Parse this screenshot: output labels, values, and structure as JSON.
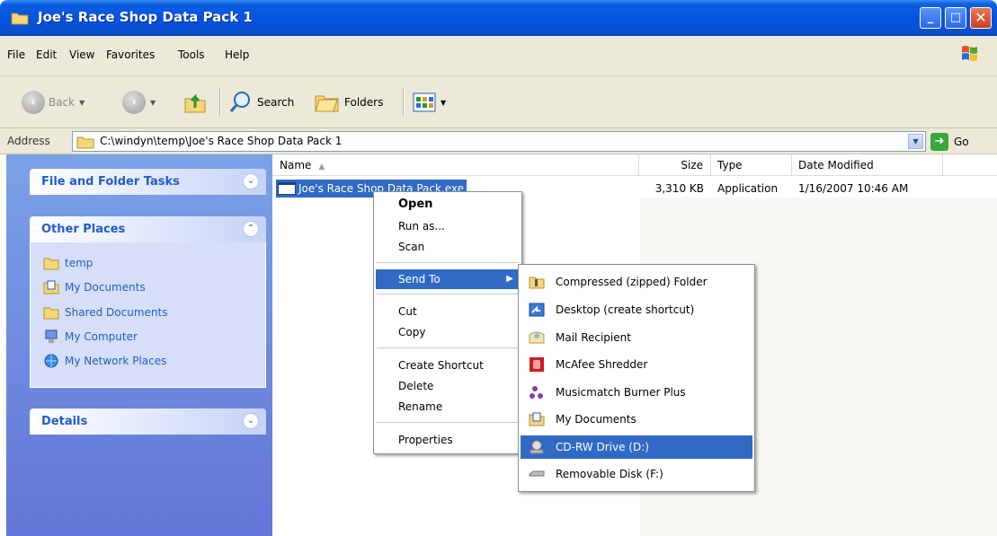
{
  "window": {
    "title": "Joe's Race Shop Data Pack 1",
    "minimize": "_",
    "maximize": "□",
    "close": "✕"
  },
  "menubar": [
    "File",
    "Edit",
    "View",
    "Favorites",
    "Tools",
    "Help"
  ],
  "toolbar": {
    "back": "Back",
    "search": "Search",
    "folders": "Folders"
  },
  "address": {
    "label": "Address",
    "value": "C:\\windyn\\temp\\Joe's Race Shop Data Pack 1",
    "go": "Go"
  },
  "leftpane": {
    "file_tasks": "File and Folder Tasks",
    "other_places": "Other Places",
    "places": [
      "temp",
      "My Documents",
      "Shared Documents",
      "My Computer",
      "My Network Places"
    ],
    "details": "Details"
  },
  "columns": {
    "name": "Name",
    "size": "Size",
    "type": "Type",
    "date": "Date Modified"
  },
  "file": {
    "name": "Joe's Race Shop Data Pack.exe",
    "size": "3,310 KB",
    "type": "Application",
    "date": "1/16/2007 10:46 AM"
  },
  "context_menu": {
    "open": "Open",
    "run_as": "Run as...",
    "scan": "Scan",
    "send_to": "Send To",
    "cut": "Cut",
    "copy": "Copy",
    "create_shortcut": "Create Shortcut",
    "delete": "Delete",
    "rename": "Rename",
    "properties": "Properties"
  },
  "send_to_menu": [
    "Compressed (zipped) Folder",
    "Desktop (create shortcut)",
    "Mail Recipient",
    "McAfee Shredder",
    "Musicmatch Burner Plus",
    "My Documents",
    "CD-RW Drive (D:)",
    "Removable Disk (F:)"
  ],
  "colors": {
    "titlebar": "#0550dd",
    "selection": "#316ac5",
    "taskpane": "#6375d6",
    "link": "#215dc6"
  }
}
